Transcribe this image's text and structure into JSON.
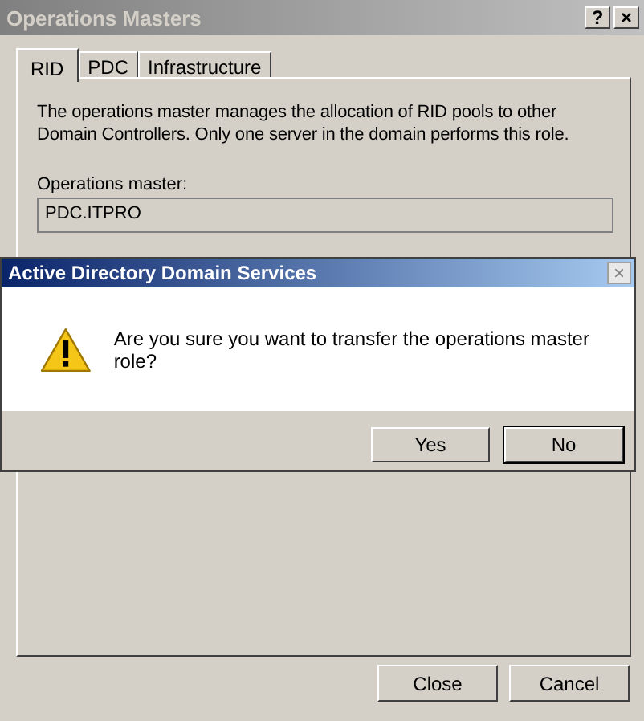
{
  "window": {
    "title": "Operations Masters",
    "help_button": "?",
    "close_button": "×"
  },
  "tabs": [
    {
      "label": "RID",
      "selected": true
    },
    {
      "label": "PDC",
      "selected": false
    },
    {
      "label": "Infrastructure",
      "selected": false
    }
  ],
  "description": "The operations master manages the allocation of RID pools to other Domain Controllers. Only one server in the domain performs this role.",
  "operations_master": {
    "label": "Operations master:",
    "value": "PDC.ITPRO"
  },
  "buttons": [
    "Close",
    "Cancel"
  ],
  "message_box": {
    "title": "Active Directory Domain Services",
    "close_button": "×",
    "message": "Are you sure you want to transfer the operations master role?",
    "buttons": [
      {
        "label": "Yes",
        "default": false
      },
      {
        "label": "No",
        "default": true
      }
    ]
  }
}
